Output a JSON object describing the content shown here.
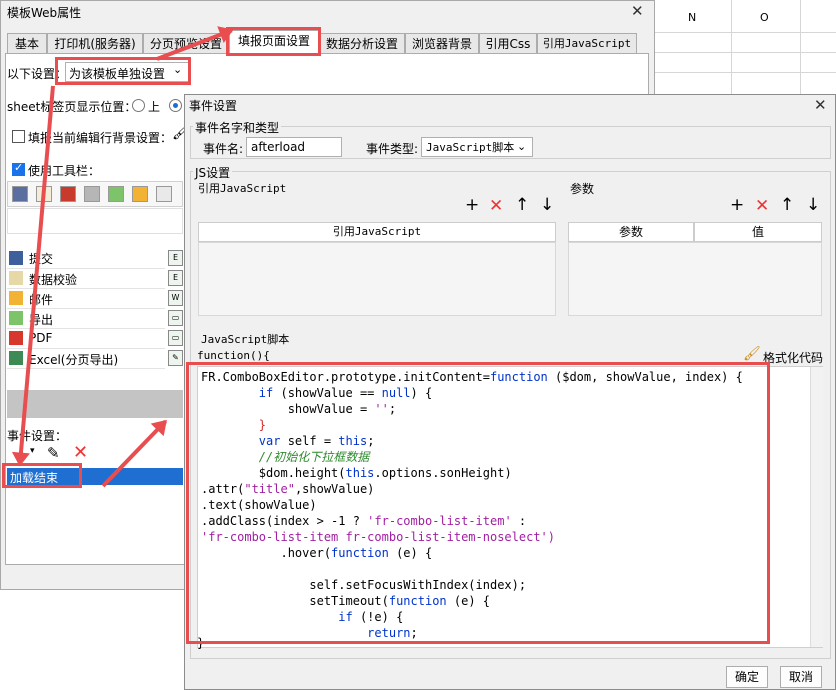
{
  "sheet": {
    "col_n": "N",
    "col_o": "O"
  },
  "outer": {
    "title": "模板Web属性",
    "close": "✕",
    "tabs": [
      "基本",
      "打印机(服务器)",
      "分页预览设置",
      "填报页面设置",
      "数据分析设置",
      "浏览器背景",
      "引用Css",
      "引用JavaScript"
    ],
    "setting_label": "以下设置：",
    "setting_value": "为该模板单独设置",
    "sheet_pos_label": "sheet标签页显示位置：",
    "sheet_pos_up": "上",
    "fill_bg_label": "填报当前编辑行背景设置：",
    "use_toolbar_label": "使用工具栏：",
    "list_items": [
      "提交",
      "数据校验",
      "邮件",
      "导出",
      "PDF",
      "Excel(分页导出)"
    ],
    "event_label": "事件设置：",
    "event_item": "加载结束"
  },
  "inner": {
    "title": "事件设置",
    "close": "✕",
    "group_name_type": "事件名字和类型",
    "event_name_label": "事件名:",
    "event_name_value": "afterload",
    "event_type_label": "事件类型:",
    "event_type_value": "JavaScript脚本",
    "js_settings": "JS设置",
    "ref_js_label": "引用JavaScript",
    "params_label": "参数",
    "ref_js_col": "引用JavaScript",
    "param_col": "参数",
    "value_col": "值",
    "js_script_label": "JavaScript脚本",
    "function_open": "function(){",
    "format_code": "格式化代码",
    "function_close": "}",
    "ok": "确定",
    "cancel": "取消"
  },
  "code": [
    "FR.ComboBoxEditor.prototype.initContent=function ($dom, showValue, index) {",
    "        if (showValue == null) {",
    "            showValue = '';",
    "        }",
    "        var self = this;",
    "        //初始化下拉框数据",
    "        $dom.height(this.options.sonHeight)",
    ".attr(\"title\",showValue)",
    ".text(showValue)",
    ".addClass(index > -1 ? 'fr-combo-list-item' :",
    "'fr-combo-list-item fr-combo-list-item-noselect')",
    "           .hover(function (e) {",
    "",
    "               self.setFocusWithIndex(index);",
    "               setTimeout(function (e) {",
    "                   if (!e) {",
    "                       return;"
  ],
  "colors": {
    "accent_red": "#e84d50",
    "selection_blue": "#1e6fd1",
    "keyword_blue": "#0033cc"
  }
}
